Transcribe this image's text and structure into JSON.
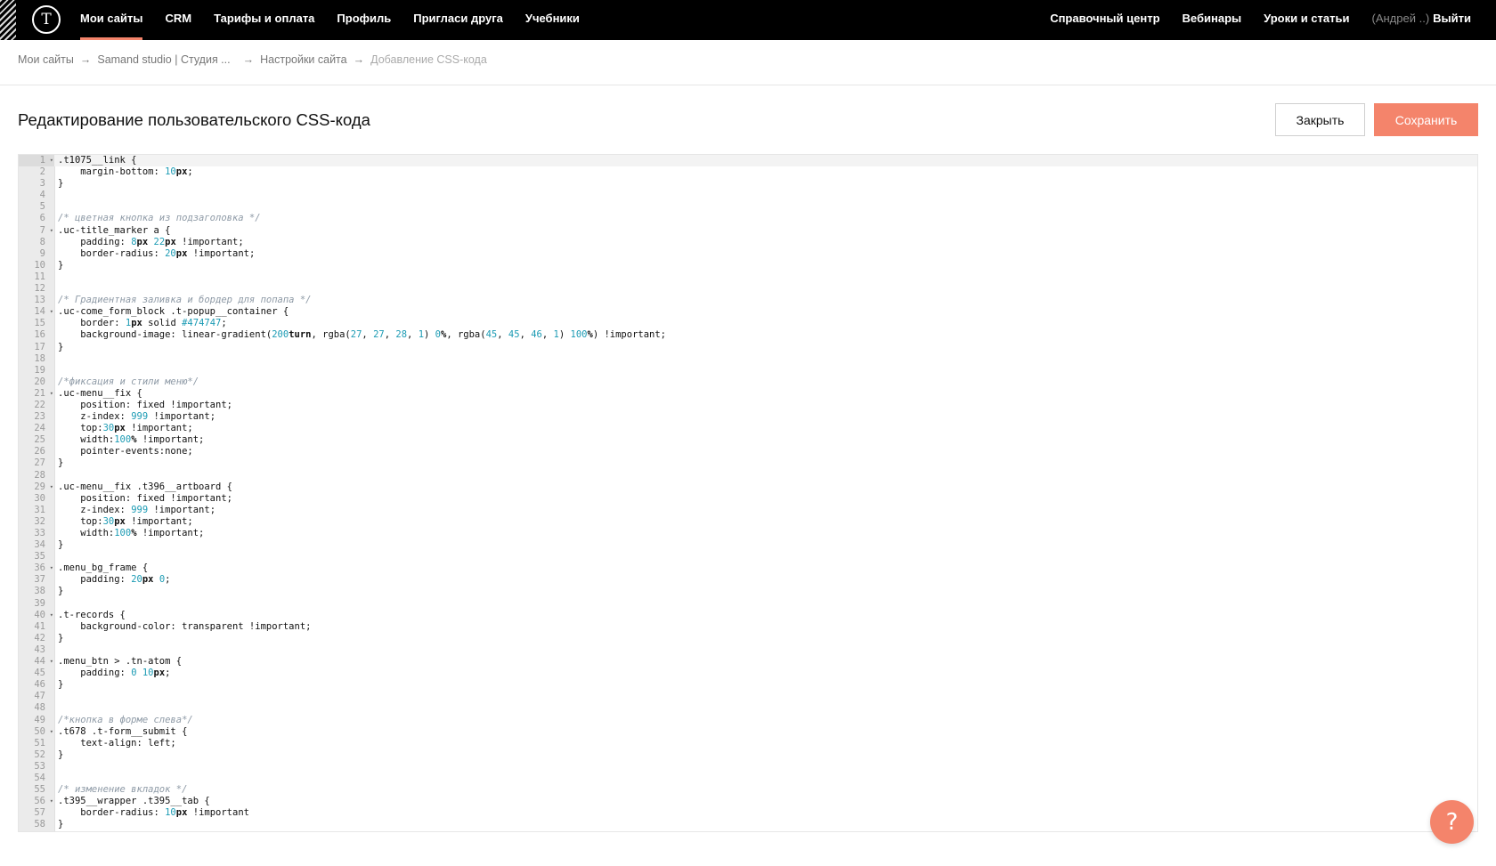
{
  "colors": {
    "accent": "#f4846b",
    "topbar": "#000000",
    "number": "#1c9bb4",
    "comment": "#8e9aa6"
  },
  "topbar": {
    "logo_icon": "tilda-logo-icon",
    "logo_letter": "T",
    "nav_left": [
      "Мои сайты",
      "CRM",
      "Тарифы и оплата",
      "Профиль",
      "Пригласи друга",
      "Учебники"
    ],
    "nav_right": [
      "Справочный центр",
      "Вебинары",
      "Уроки и статьи"
    ],
    "user_name": "(Андрей ..)",
    "logout_label": "Выйти"
  },
  "breadcrumb": {
    "items": [
      "Мои сайты",
      "Samand studio | Студия ...",
      "Настройки сайта"
    ],
    "current": "Добавление CSS-кода",
    "separator": "→"
  },
  "page": {
    "title": "Редактирование пользовательского CSS-кода",
    "close_label": "Закрыть",
    "save_label": "Сохранить"
  },
  "editor": {
    "active_line": 1,
    "lines": [
      ".t1075__link {",
      "    margin-bottom: 10px;",
      "}",
      "",
      "",
      "/* цветная кнопка из подзаголовка */",
      ".uc-title_marker a {",
      "    padding: 8px 22px !important;",
      "    border-radius: 20px !important;",
      "}",
      "",
      "",
      "/* Градиентная заливка и бордер для попапа */",
      ".uc-come_form_block .t-popup__container {",
      "    border: 1px solid #474747;",
      "    background-image: linear-gradient(200turn, rgba(27, 27, 28, 1) 0%, rgba(45, 45, 46, 1) 100%) !important;",
      "}",
      "",
      "",
      "/*фиксация и стили меню*/",
      ".uc-menu__fix {",
      "    position: fixed !important;",
      "    z-index: 999 !important;",
      "    top:30px !important;",
      "    width:100% !important;",
      "    pointer-events:none;",
      "}",
      "",
      ".uc-menu__fix .t396__artboard {",
      "    position: fixed !important;",
      "    z-index: 999 !important;",
      "    top:30px !important;",
      "    width:100% !important;",
      "}",
      "",
      ".menu_bg_frame {",
      "    padding: 20px 0;",
      "}",
      "",
      ".t-records {",
      "    background-color: transparent !important;",
      "}",
      "",
      ".menu_btn > .tn-atom {",
      "    padding: 0 10px;",
      "}",
      "",
      "",
      "/*кнопка в форме слева*/",
      ".t678 .t-form__submit {",
      "    text-align: left;",
      "}",
      "",
      "",
      "/* изменение вкладок */",
      ".t395__wrapper .t395__tab {",
      "    border-radius: 10px !important",
      "}"
    ]
  },
  "help": {
    "icon": "question-icon",
    "glyph": "?"
  }
}
